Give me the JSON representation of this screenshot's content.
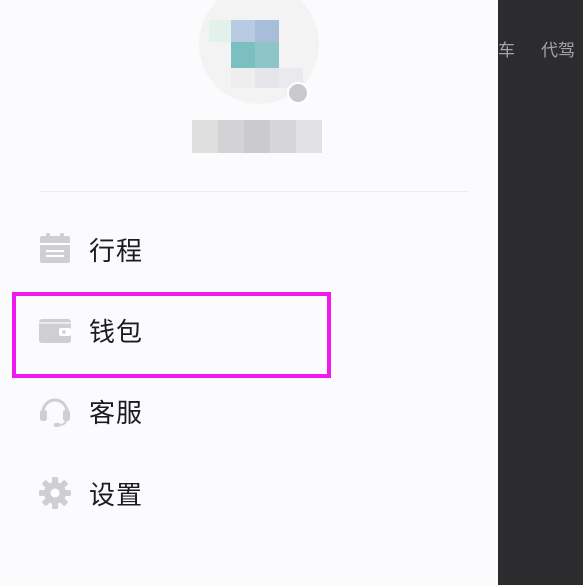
{
  "background": {
    "tabs": [
      "车",
      "代驾"
    ]
  },
  "drawer": {
    "profile": {
      "name": "",
      "avatar_icon": "avatar-image"
    },
    "menu": [
      {
        "label": "行程",
        "icon": "calendar-icon"
      },
      {
        "label": "钱包",
        "icon": "wallet-icon"
      },
      {
        "label": "客服",
        "icon": "headset-icon"
      },
      {
        "label": "设置",
        "icon": "gear-icon"
      }
    ],
    "highlighted_item": "钱包"
  },
  "colors": {
    "icon_gray": "#cfcfd3",
    "highlight": "#ee1aee",
    "drawer_bg": "#fbfbfd",
    "overlay_bg": "#2c2b2d"
  }
}
